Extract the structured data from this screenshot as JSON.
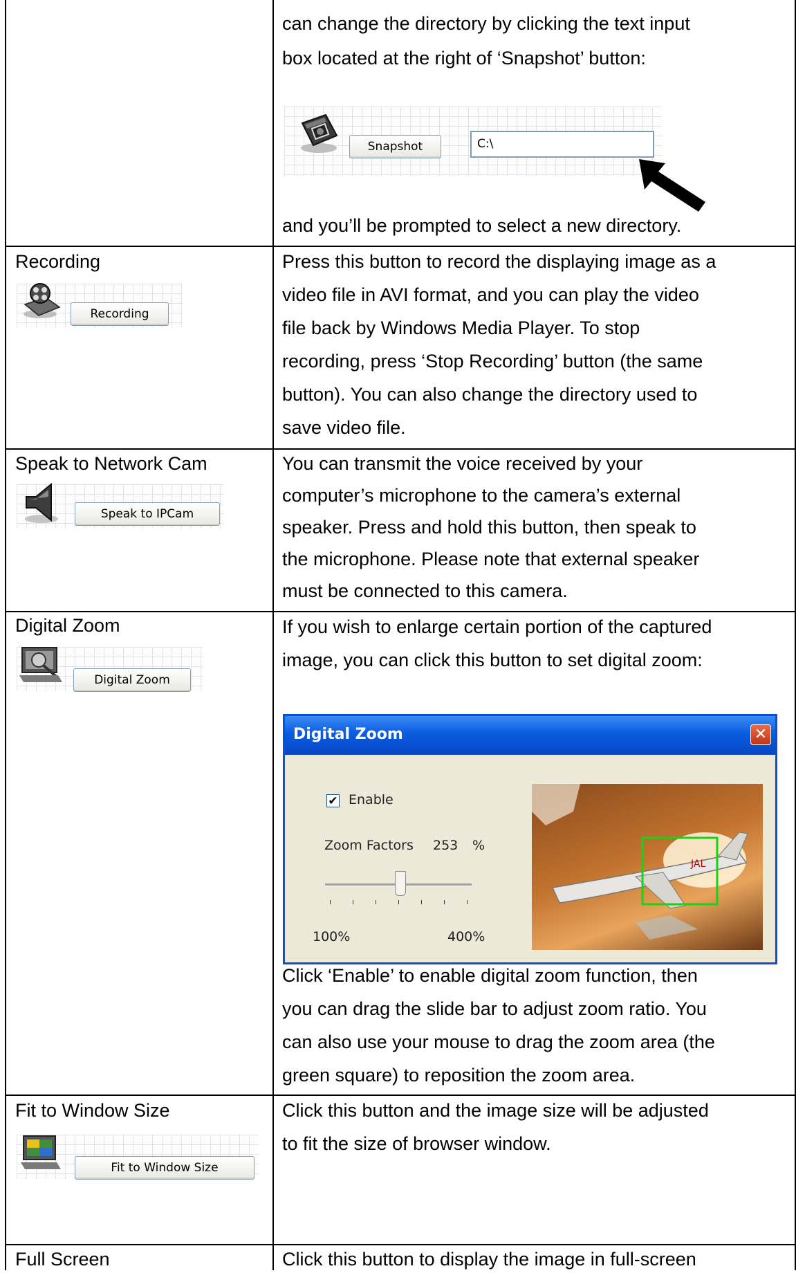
{
  "snapshot_row": {
    "lines": [
      "can change the directory by clicking the text input",
      "box located at the right of ‘Snapshot’ button:",
      "and you’ll be prompted to select a new directory."
    ],
    "button_label": "Snapshot",
    "path_value": "C:\\"
  },
  "recording_row": {
    "title": "Recording",
    "button_label": "Recording",
    "lines": [
      "Press this button to record the displaying image as a",
      "video file in AVI format, and you can play the video",
      "file back by Windows Media Player. To stop",
      "recording, press ‘Stop Recording’ button (the same",
      "button). You can also change the directory used to",
      "save video file."
    ]
  },
  "speak_row": {
    "title": "Speak to Network Cam",
    "button_label": "Speak to IPCam",
    "lines": [
      "You can transmit the voice received by your",
      "computer’s microphone to the camera’s external",
      "speaker. Press and hold this button, then speak to",
      "the microphone. Please note that external speaker",
      "must be connected to this camera."
    ]
  },
  "zoom_row": {
    "title": "Digital Zoom",
    "button_label": "Digital Zoom",
    "lines": [
      "If you wish to enlarge certain portion of the captured",
      "image, you can click this button to set digital zoom:"
    ],
    "dialog": {
      "title": "Digital Zoom",
      "close_glyph": "✕",
      "enable_label": "Enable",
      "enable_checked": true,
      "check_glyph": "✔",
      "zoom_factors_label": "Zoom Factors",
      "zoom_value": "253",
      "zoom_unit": "%",
      "min_label": "100%",
      "max_label": "400%",
      "slider_min": 100,
      "slider_max": 400,
      "slider_value": 253,
      "tail_text": "JAL"
    },
    "after_lines": [
      "Click ‘Enable’ to enable digital zoom function, then",
      "you can drag the slide bar to adjust zoom ratio. You",
      "can also use your mouse to drag the zoom area (the",
      "green square) to reposition the zoom area."
    ]
  },
  "fit_row": {
    "title": "Fit to Window Size",
    "button_label": "Fit to Window Size",
    "lines": [
      "Click this button and the image size will be adjusted",
      "to fit the size of browser window."
    ]
  },
  "full_row": {
    "title": "Full Screen",
    "lines": [
      "Click this button to display the image in full-screen"
    ]
  }
}
